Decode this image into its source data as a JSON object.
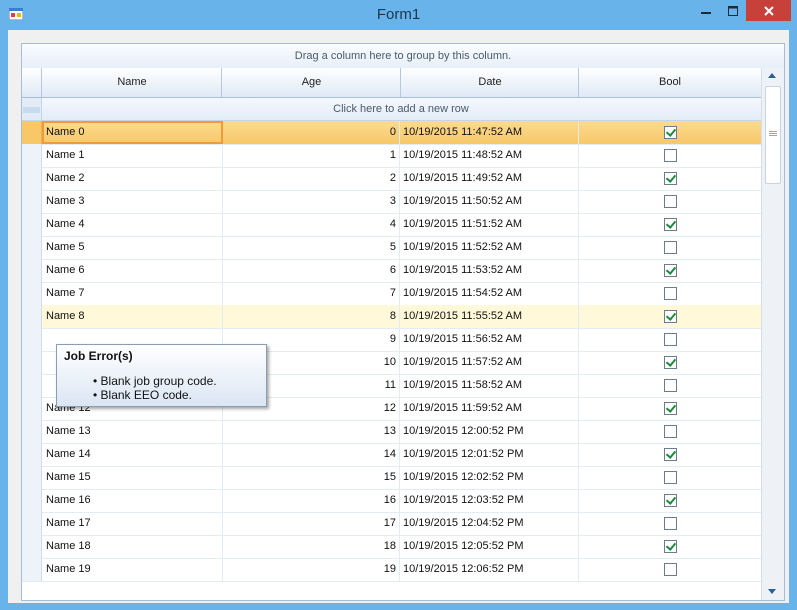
{
  "window": {
    "title": "Form1"
  },
  "grid": {
    "group_panel_text": "Drag a column here to group by this column.",
    "new_row_text": "Click here to add a new row",
    "columns": [
      "Name",
      "Age",
      "Date",
      "Bool"
    ],
    "rows": [
      {
        "name": "Name 0",
        "age": "0",
        "date": "10/19/2015 11:47:52 AM",
        "bool": true
      },
      {
        "name": "Name 1",
        "age": "1",
        "date": "10/19/2015 11:48:52 AM",
        "bool": false
      },
      {
        "name": "Name 2",
        "age": "2",
        "date": "10/19/2015 11:49:52 AM",
        "bool": true
      },
      {
        "name": "Name 3",
        "age": "3",
        "date": "10/19/2015 11:50:52 AM",
        "bool": false
      },
      {
        "name": "Name 4",
        "age": "4",
        "date": "10/19/2015 11:51:52 AM",
        "bool": true
      },
      {
        "name": "Name 5",
        "age": "5",
        "date": "10/19/2015 11:52:52 AM",
        "bool": false
      },
      {
        "name": "Name 6",
        "age": "6",
        "date": "10/19/2015 11:53:52 AM",
        "bool": true
      },
      {
        "name": "Name 7",
        "age": "7",
        "date": "10/19/2015 11:54:52 AM",
        "bool": false
      },
      {
        "name": "Name 8",
        "age": "8",
        "date": "10/19/2015 11:55:52 AM",
        "bool": true
      },
      {
        "name": "",
        "age": "9",
        "date": "10/19/2015 11:56:52 AM",
        "bool": false
      },
      {
        "name": "",
        "age": "10",
        "date": "10/19/2015 11:57:52 AM",
        "bool": true
      },
      {
        "name": "",
        "age": "11",
        "date": "10/19/2015 11:58:52 AM",
        "bool": false
      },
      {
        "name": "Name 12",
        "age": "12",
        "date": "10/19/2015 11:59:52 AM",
        "bool": true
      },
      {
        "name": "Name 13",
        "age": "13",
        "date": "10/19/2015 12:00:52 PM",
        "bool": false
      },
      {
        "name": "Name 14",
        "age": "14",
        "date": "10/19/2015 12:01:52 PM",
        "bool": true
      },
      {
        "name": "Name 15",
        "age": "15",
        "date": "10/19/2015 12:02:52 PM",
        "bool": false
      },
      {
        "name": "Name 16",
        "age": "16",
        "date": "10/19/2015 12:03:52 PM",
        "bool": true
      },
      {
        "name": "Name 17",
        "age": "17",
        "date": "10/19/2015 12:04:52 PM",
        "bool": false
      },
      {
        "name": "Name 18",
        "age": "18",
        "date": "10/19/2015 12:05:52 PM",
        "bool": true
      },
      {
        "name": "Name 19",
        "age": "19",
        "date": "10/19/2015 12:06:52 PM",
        "bool": false
      }
    ],
    "selected_row": 0,
    "hover_row": 8
  },
  "tooltip": {
    "title": "Job Error(s)",
    "items": [
      "• Blank job group code.",
      "• Blank EEO code."
    ]
  },
  "icons": {
    "app": "app-form-icon",
    "minimize": "minimize-icon",
    "maximize": "maximize-icon",
    "close": "close-icon"
  },
  "colors": {
    "titlebar": "#68b4ea",
    "selection": "#f8c868",
    "hover": "#fff8d9",
    "close_button": "#c7403a",
    "check": "#1c8a3a"
  }
}
